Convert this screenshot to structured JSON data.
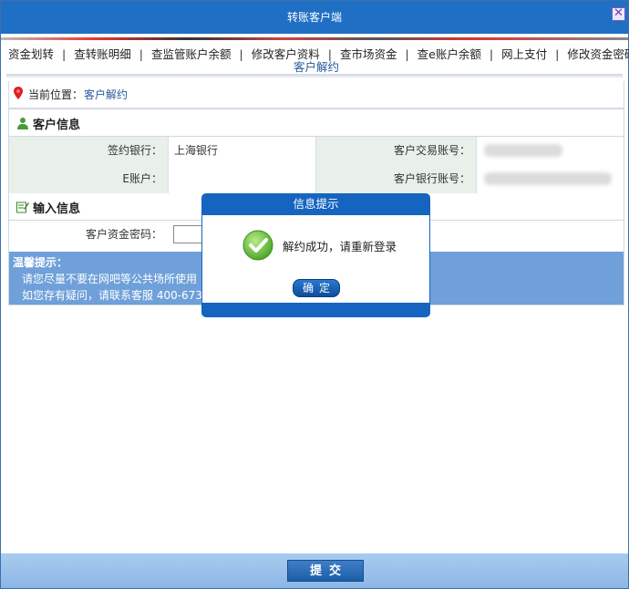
{
  "window": {
    "title": "转账客户端",
    "close_glyph": "✕"
  },
  "nav": {
    "items": [
      {
        "label": "资金划转"
      },
      {
        "label": "查转账明细"
      },
      {
        "label": "查监管账户余额"
      },
      {
        "label": "修改客户资料"
      },
      {
        "label": "查市场资金"
      },
      {
        "label": "查e账户余额"
      },
      {
        "label": "网上支付"
      },
      {
        "label": "修改资金密码"
      }
    ],
    "separator": "|",
    "current": "客户解约"
  },
  "location": {
    "label": "当前位置：",
    "value": "客户解约"
  },
  "customer_info": {
    "title": "客户信息",
    "rows": [
      {
        "label1": "签约银行：",
        "value1": "上海银行",
        "label2": "客户交易账号："
      },
      {
        "label1": "E账户：",
        "value1": "",
        "label2": "客户银行账号："
      }
    ]
  },
  "input_info": {
    "title": "输入信息",
    "password_label": "客户资金密码："
  },
  "tips": {
    "title": "温馨提示：",
    "line1": "请您尽量不要在网吧等公共场所使用",
    "line2": "如您存有疑问，请联系客服  400-673-3"
  },
  "dialog": {
    "title": "信息提示",
    "message": "解约成功，请重新登录",
    "ok_label": "确定"
  },
  "footer": {
    "submit_label": "提交"
  },
  "colors": {
    "titlebar": "#1f6fc5",
    "tips_bg": "#6fa0d9",
    "dialog": "#1565c0",
    "success": "#6bbf3a"
  }
}
